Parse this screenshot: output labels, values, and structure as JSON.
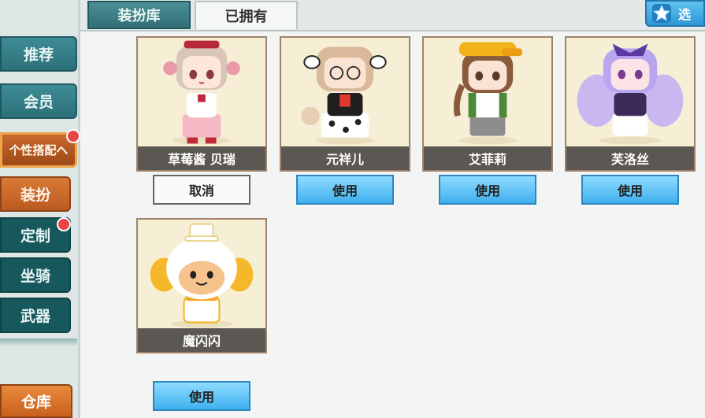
{
  "tabs": {
    "wardrobe": "装扮库",
    "owned": "已拥有"
  },
  "top_right_label": "选",
  "sidebar": {
    "recommend": "推荐",
    "membership": "会员",
    "personal_match": "个性搭配へ",
    "dress_up": "装扮",
    "customize": "定制",
    "mounts": "坐骑",
    "weapons": "武器",
    "warehouse": "仓库"
  },
  "skins": [
    {
      "name": "草莓酱 贝瑞",
      "action": "取消",
      "state": "equipped"
    },
    {
      "name": "元祥儿",
      "action": "使用",
      "state": "owned"
    },
    {
      "name": "艾菲莉",
      "action": "使用",
      "state": "owned"
    },
    {
      "name": "芙洛丝",
      "action": "使用",
      "state": "owned"
    },
    {
      "name": "魔闪闪",
      "action": "使用",
      "state": "owned"
    }
  ],
  "colors": {
    "accent_teal": "#2c717a",
    "accent_orange": "#c8601d",
    "use_button_blue": "#3fb0ef",
    "badge_red": "#e84646"
  }
}
